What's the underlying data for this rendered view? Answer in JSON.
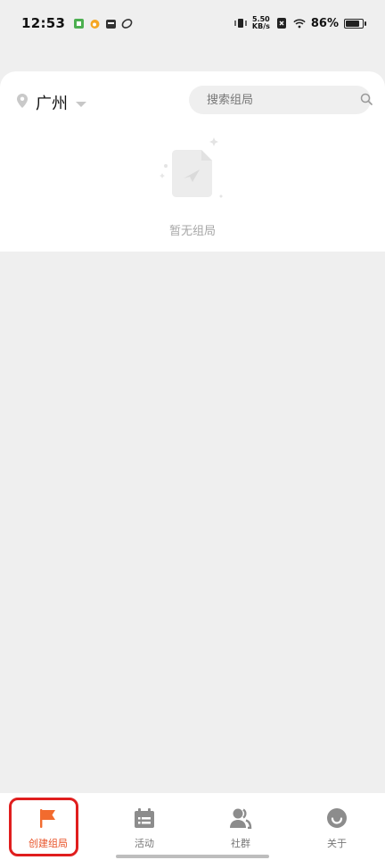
{
  "status_bar": {
    "time": "12:53",
    "net_speed_value": "5.50",
    "net_speed_unit": "KB/s",
    "battery_percent": "86%",
    "battery_level": 0.86
  },
  "location": {
    "city": "广州"
  },
  "search": {
    "placeholder": "搜索组局"
  },
  "empty_state": {
    "text": "暂无组局"
  },
  "tabbar": {
    "active_color": "#e8542a",
    "inactive_color": "#8c8c8c",
    "tabs": [
      {
        "label": "创建组局",
        "icon": "flag-icon",
        "active": true
      },
      {
        "label": "活动",
        "icon": "calendar-list-icon",
        "active": false
      },
      {
        "label": "社群",
        "icon": "users-icon",
        "active": false
      },
      {
        "label": "关于",
        "icon": "smile-icon",
        "active": false
      }
    ]
  }
}
